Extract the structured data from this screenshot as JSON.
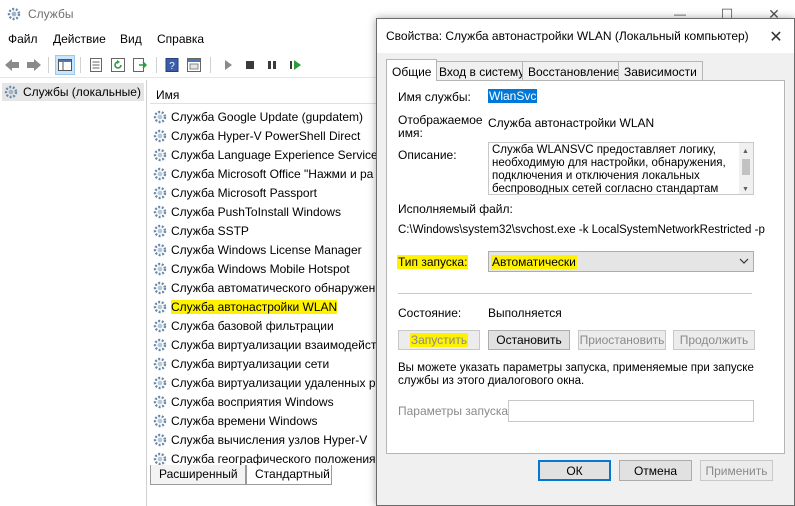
{
  "main": {
    "title": "Службы",
    "menu": [
      "Файл",
      "Действие",
      "Вид",
      "Справка"
    ],
    "tree_root": "Службы (локальные)",
    "column_name": "Имя",
    "services": [
      "Служба Google Update (gupdatem)",
      "Служба Hyper-V PowerShell Direct",
      "Служба Language Experience Service",
      "Служба Microsoft Office \"Нажми и ра",
      "Служба Microsoft Passport",
      "Служба PushToInstall Windows",
      "Служба SSTP",
      "Служба Windows License Manager",
      "Служба Windows Mobile Hotspot",
      "Служба автоматического обнаружен",
      "Служба автонастройки WLAN",
      "Служба базовой фильтрации",
      "Служба виртуализации взаимодейст",
      "Служба виртуализации сети",
      "Служба виртуализации удаленных ра",
      "Служба восприятия Windows",
      "Служба времени Windows",
      "Служба вычисления узлов Hyper-V",
      "Служба географического положения"
    ],
    "highlighted_service_index": 10,
    "bottom_tabs": [
      "Расширенный",
      "Стандартный"
    ],
    "window_controls": {
      "minimize": "—",
      "maximize": "☐",
      "close": "✕"
    }
  },
  "dialog": {
    "title": "Свойства: Служба автонастройки WLAN (Локальный компьютер)",
    "close": "✕",
    "tabs": [
      "Общие",
      "Вход в систему",
      "Восстановление",
      "Зависимости"
    ],
    "service_name_label": "Имя службы:",
    "service_name": "WlanSvc",
    "display_name_label": "Отображаемое имя:",
    "display_name_label_line1": "Отображаемое",
    "display_name_label_line2": "имя:",
    "display_name": "Служба автонастройки WLAN",
    "description_label": "Описание:",
    "description": "Служба WLANSVC предоставляет логику, необходимую для настройки, обнаружения, подключения и отключения локальных беспроводных сетей согласно стандартам IEEE",
    "exe_label": "Исполняемый файл:",
    "exe_path": "C:\\Windows\\system32\\svchost.exe -k LocalSystemNetworkRestricted -p",
    "startup_type_label": "Тип запуска:",
    "startup_type": "Автоматически",
    "status_label": "Состояние:",
    "status": "Выполняется",
    "buttons": {
      "start": "Запустить",
      "stop": "Остановить",
      "pause": "Приостановить",
      "resume": "Продолжить"
    },
    "hint": "Вы можете указать параметры запуска, применяемые при запуске службы из этого диалогового окна.",
    "hint_line1": "Вы можете указать параметры запуска, применяемые при запуске",
    "hint_line2": "службы из этого диалогового окна.",
    "params_label": "Параметры запуска:",
    "params_value": "",
    "ok": "ОК",
    "cancel": "Отмена",
    "apply": "Применить"
  },
  "colors": {
    "highlight_yellow": "#fff200",
    "selection_blue": "#0078d7"
  }
}
